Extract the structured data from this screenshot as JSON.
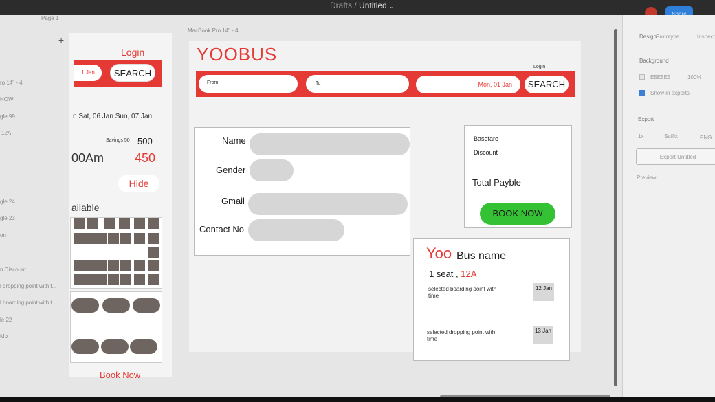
{
  "topbar": {
    "drafts": "Drafts",
    "separator": "/",
    "file_name": "Untitled",
    "chevron": "⌄",
    "share_label": "Share"
  },
  "layers": {
    "page": "Page 1",
    "add": "+",
    "items": [
      "ro 14\" - 4",
      "NOW",
      "gle 99",
      "12A",
      "gle 24",
      "gle 23",
      "on",
      "n Discount",
      "l dropping point with t...",
      "l boarding point with t...",
      "le 22",
      "Mo"
    ]
  },
  "left_frame": {
    "login": "Login",
    "jan": "1 Jan",
    "search": "SEARCH",
    "dates": "n Sat, 06 Jan  Sun, 07 Jan",
    "savings": "Savings 50",
    "price_old": "500",
    "time": "00Am",
    "price_new": "450",
    "hide": "Hide",
    "available": "ailable",
    "book_now": "Book Now"
  },
  "main": {
    "frame_label": "MacBook Pro 14\" - 4",
    "brand": "YOOBUS",
    "login": "Login",
    "from": "From",
    "to": "To",
    "date": "Mon, 01 Jan",
    "search": "SEARCH",
    "form": {
      "name": "Name",
      "gender": "Gender",
      "gmail": "Gmail",
      "contact": "Contact No"
    },
    "fare": {
      "basefare": "Basefare",
      "discount": "Discount",
      "total": "Total Payble",
      "book_now": "BOOK NOW"
    },
    "bus": {
      "yoo": "Yoo",
      "bus_name": "Bus name",
      "seat_prefix": "1 seat ,",
      "seat_no": "12A",
      "boarding": "selected boarding point with time",
      "boarding_date": "12 Jan",
      "dropping": "selected dropping point with time",
      "dropping_date": "13 Jan"
    }
  },
  "right_panel": {
    "design": "Design",
    "tab2": "Prototype",
    "tab3": "Inspect",
    "background": "Background",
    "bg_hex": "E5E5E5",
    "bg_pct": "100%",
    "show_exports": "Show in exports",
    "export": "Export",
    "scale": "1x",
    "suffix": "Suffix",
    "format": "PNG",
    "export_button": "Export Untitled",
    "preview": "Preview"
  },
  "colors": {
    "accent": "#e53935",
    "book_green": "#34c234",
    "seat": "#6f6560"
  }
}
